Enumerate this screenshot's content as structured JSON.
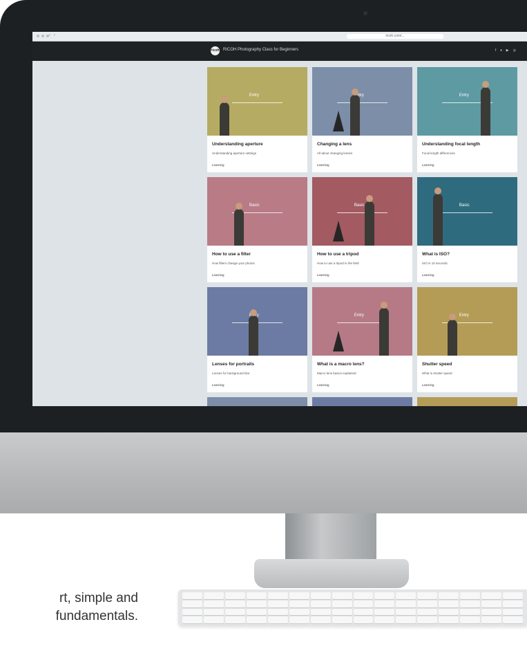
{
  "browser": {
    "url": "ricoh.com/..."
  },
  "site": {
    "logo_text": "ricoh",
    "title": "RICOH Photography Class for Beginners",
    "social_icons": [
      "facebook-icon",
      "twitter-icon",
      "youtube-icon",
      "instagram-icon"
    ]
  },
  "cards": [
    {
      "tag": "Entry",
      "title": "Understanding aperture",
      "subtitle": "Understanding aperture settings",
      "label": "Learning",
      "color": "#b6ab62"
    },
    {
      "tag": "Entry",
      "title": "Changing a lens",
      "subtitle": "All about changing lenses",
      "label": "Learning",
      "color": "#7c8ea8"
    },
    {
      "tag": "Entry",
      "title": "Understanding focal length",
      "subtitle": "Focal length differences",
      "label": "Learning",
      "color": "#5d9aa1"
    },
    {
      "tag": "Basic",
      "title": "How to use a filter",
      "subtitle": "How filters change your photos",
      "label": "Learning",
      "color": "#b97b86"
    },
    {
      "tag": "Basic",
      "title": "How to use a tripod",
      "subtitle": "How to use a tripod in the field",
      "label": "Learning",
      "color": "#a35a61"
    },
    {
      "tag": "Basic",
      "title": "What is ISO?",
      "subtitle": "ISO in 10 seconds",
      "label": "Learning",
      "color": "#2f6b7f"
    },
    {
      "tag": "Entry",
      "title": "Lenses for portraits",
      "subtitle": "Lenses for background blur",
      "label": "Learning",
      "color": "#6c7ba3"
    },
    {
      "tag": "Entry",
      "title": "What is a macro lens?",
      "subtitle": "Macro lens basics explained",
      "label": "Learning",
      "color": "#b67a86"
    },
    {
      "tag": "Entry",
      "title": "Shutter speed",
      "subtitle": "What is shutter speed",
      "label": "Learning",
      "color": "#b49c56"
    }
  ],
  "caption": {
    "line1": "rt, simple and",
    "line2": "fundamentals."
  }
}
